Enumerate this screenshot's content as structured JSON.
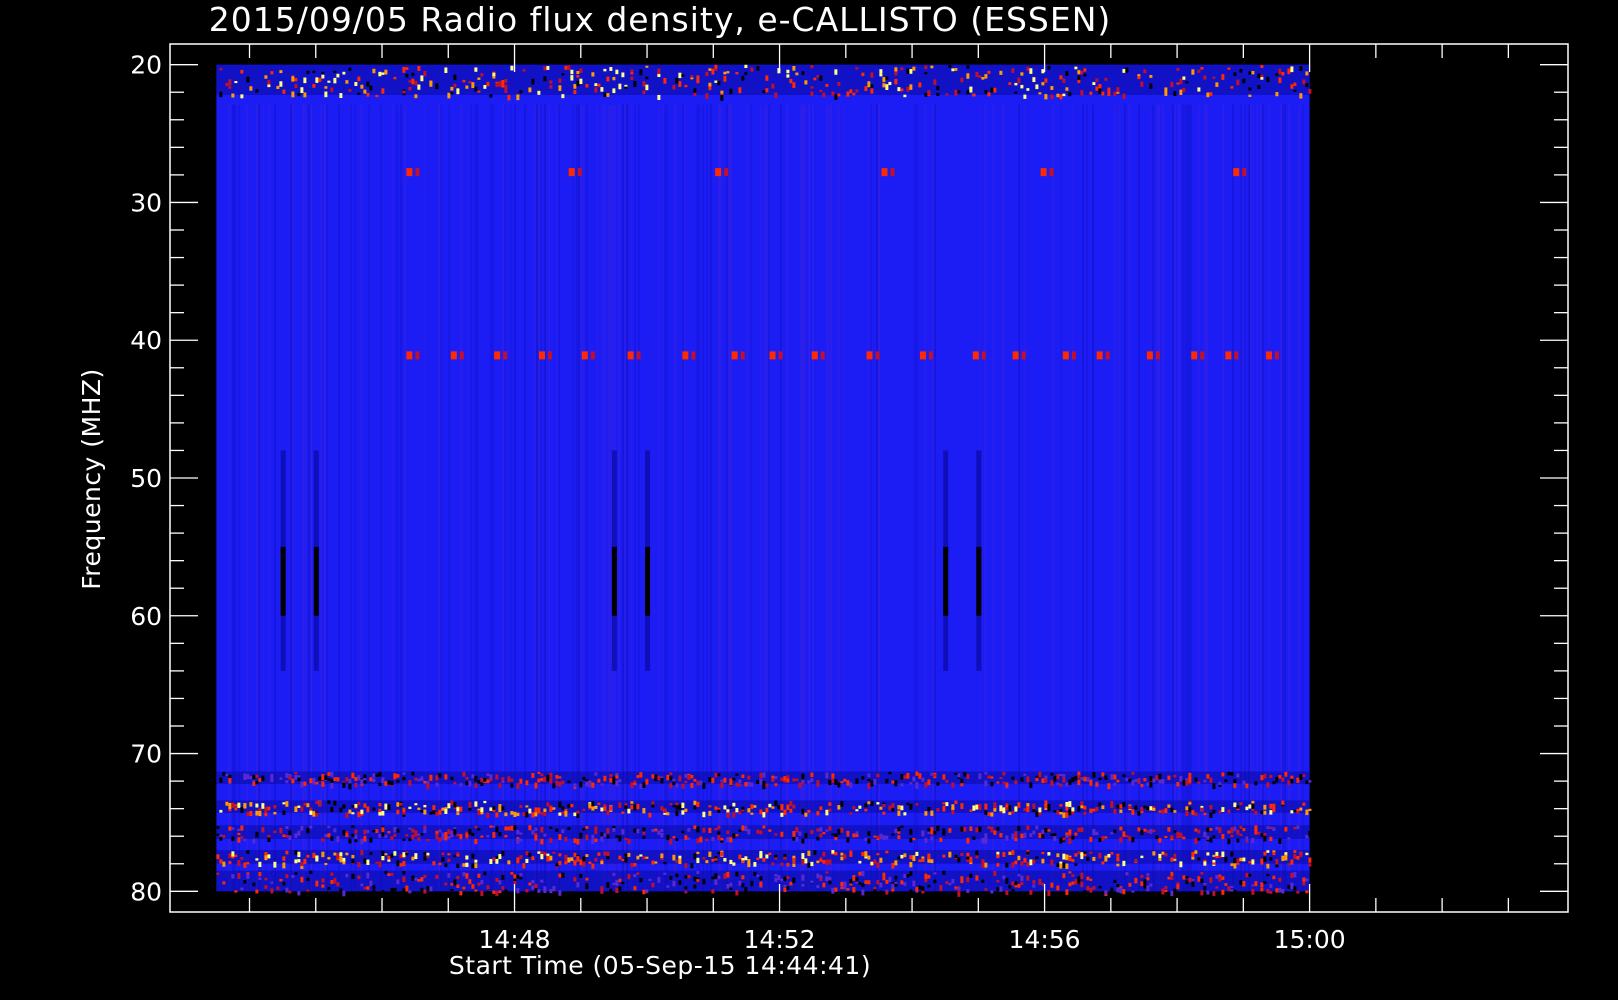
{
  "chart_data": {
    "type": "heatmap",
    "title": "2015/09/05  Radio flux density, e-CALLISTO (ESSEN)",
    "xlabel": "Start Time (05-Sep-15 14:44:41)",
    "ylabel": "Frequency (MHZ)",
    "x_tick_labels": [
      "14:48",
      "14:52",
      "14:56",
      "15:00"
    ],
    "x_ticks_minutes": [
      228,
      232,
      236,
      240
    ],
    "y_tick_labels": [
      "20",
      "30",
      "40",
      "50",
      "60",
      "70",
      "80"
    ],
    "y_ticks": [
      20,
      30,
      40,
      50,
      60,
      70,
      80
    ],
    "xlim_minutes": [
      223.5,
      240.0
    ],
    "xaxis_range_minutes": [
      222.8,
      243.9
    ],
    "yaxis_range": [
      18.5,
      81.5
    ],
    "y_reversed": true,
    "colormap": [
      "#000000",
      "#0a0aa0",
      "#1a1aff",
      "#5a2ad0",
      "#c0102a",
      "#ff2a00",
      "#ff9a00",
      "#ffff80"
    ],
    "background_color": "#1c1cf4",
    "features": [
      {
        "kind": "band",
        "freq_range": [
          20,
          22.2
        ],
        "intensity": "high"
      },
      {
        "kind": "band",
        "freq_range": [
          71.3,
          72.2
        ],
        "intensity": "medium"
      },
      {
        "kind": "band",
        "freq_range": [
          73.4,
          74.3
        ],
        "intensity": "high"
      },
      {
        "kind": "band",
        "freq_range": [
          75.2,
          76.2
        ],
        "intensity": "medium"
      },
      {
        "kind": "band",
        "freq_range": [
          77.0,
          78.0
        ],
        "intensity": "high"
      },
      {
        "kind": "band",
        "freq_range": [
          78.5,
          80
        ],
        "intensity": "medium"
      },
      {
        "kind": "spots_row",
        "freq": 41.1,
        "intensity": "medium"
      },
      {
        "kind": "spots_row",
        "freq": 27.8,
        "intensity": "medium"
      },
      {
        "kind": "dark_streak",
        "time_minutes": [
          224.5,
          225.0,
          229.5,
          230.0,
          234.5,
          235.0
        ],
        "freq_range": [
          48,
          64
        ]
      }
    ]
  }
}
